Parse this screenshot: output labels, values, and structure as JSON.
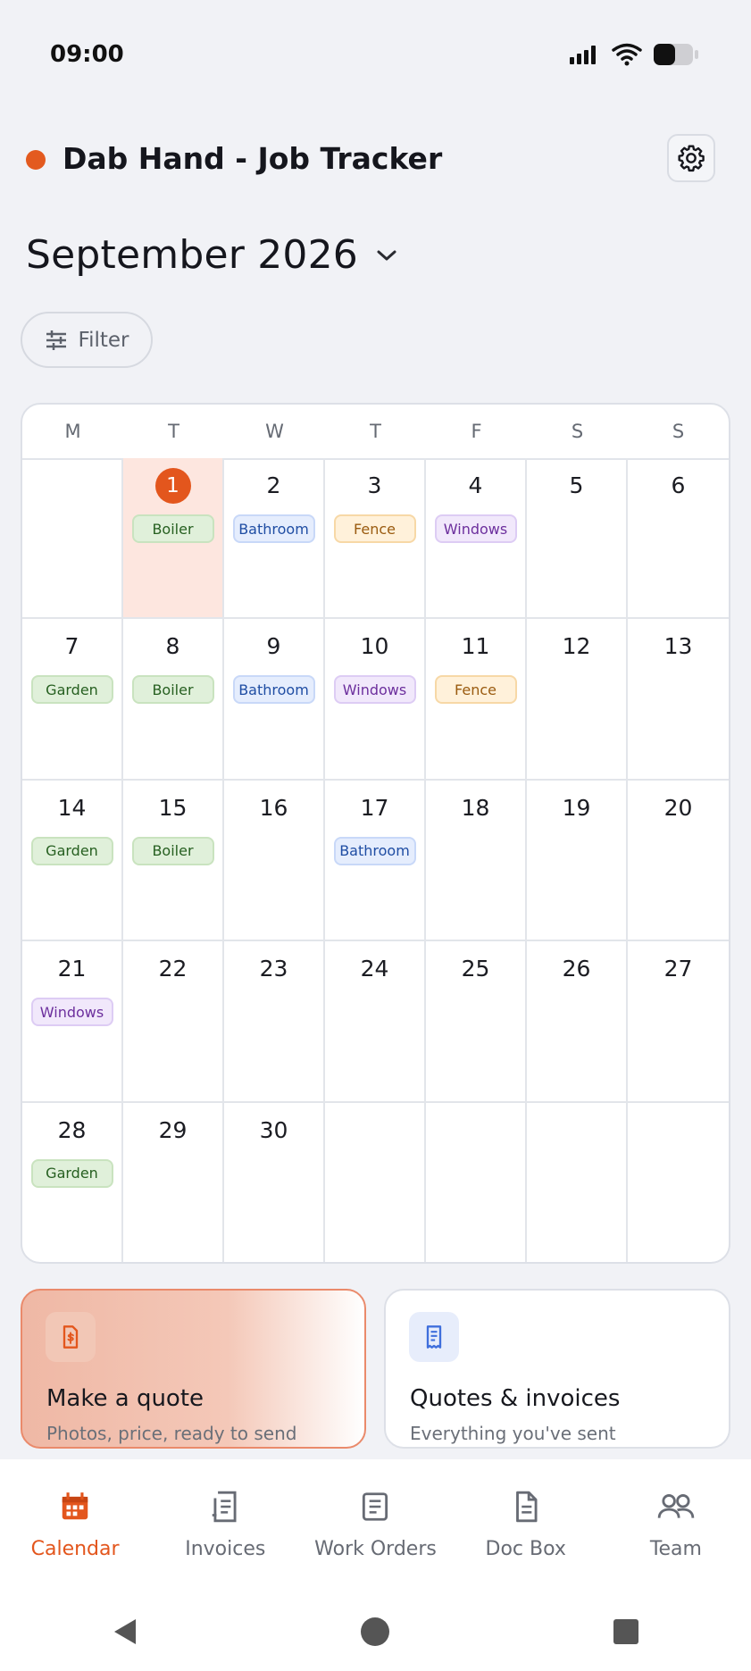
{
  "status_bar": {
    "time": "09:00",
    "icons": [
      "signal-icon",
      "wifi-icon",
      "battery-icon"
    ]
  },
  "header": {
    "title": "Dab Hand - Job Tracker",
    "icons": [
      "brand-dot-icon",
      "gear-icon"
    ],
    "accent_color": "#e35a1f"
  },
  "calendar": {
    "month_label": "September 2026",
    "filter_label": "Filter",
    "weekdays": [
      "M",
      "T",
      "W",
      "T",
      "F",
      "S",
      "S"
    ],
    "today": "1",
    "cells": [
      {
        "day": "",
        "tag": ""
      },
      {
        "day": "1",
        "tag": "Boiler"
      },
      {
        "day": "2",
        "tag": "Bathroom"
      },
      {
        "day": "3",
        "tag": "Fence"
      },
      {
        "day": "4",
        "tag": "Windows"
      },
      {
        "day": "5",
        "tag": ""
      },
      {
        "day": "6",
        "tag": ""
      },
      {
        "day": "7",
        "tag": "Garden"
      },
      {
        "day": "8",
        "tag": "Boiler"
      },
      {
        "day": "9",
        "tag": "Bathroom"
      },
      {
        "day": "10",
        "tag": "Windows"
      },
      {
        "day": "11",
        "tag": "Fence"
      },
      {
        "day": "12",
        "tag": ""
      },
      {
        "day": "13",
        "tag": ""
      },
      {
        "day": "14",
        "tag": "Garden"
      },
      {
        "day": "15",
        "tag": "Boiler"
      },
      {
        "day": "16",
        "tag": ""
      },
      {
        "day": "17",
        "tag": "Bathroom"
      },
      {
        "day": "18",
        "tag": ""
      },
      {
        "day": "19",
        "tag": ""
      },
      {
        "day": "20",
        "tag": ""
      },
      {
        "day": "21",
        "tag": "Windows"
      },
      {
        "day": "22",
        "tag": ""
      },
      {
        "day": "23",
        "tag": ""
      },
      {
        "day": "24",
        "tag": ""
      },
      {
        "day": "25",
        "tag": ""
      },
      {
        "day": "26",
        "tag": ""
      },
      {
        "day": "27",
        "tag": ""
      },
      {
        "day": "28",
        "tag": "Garden"
      },
      {
        "day": "29",
        "tag": ""
      },
      {
        "day": "30",
        "tag": ""
      },
      {
        "day": "",
        "tag": ""
      },
      {
        "day": "",
        "tag": ""
      },
      {
        "day": "",
        "tag": ""
      },
      {
        "day": "",
        "tag": ""
      }
    ]
  },
  "actions": {
    "quote": {
      "title": "Make a quote",
      "subtitle": "Photos, price, ready to send",
      "icon": "quote-document-icon"
    },
    "invoices": {
      "title": "Quotes & invoices",
      "subtitle": "Everything you've sent",
      "icon": "receipt-icon"
    }
  },
  "bottom_nav": {
    "items": [
      {
        "label": "Calendar",
        "icon": "calendar-icon"
      },
      {
        "label": "Invoices",
        "icon": "invoice-icon"
      },
      {
        "label": "Work Orders",
        "icon": "work-orders-icon"
      },
      {
        "label": "Doc Box",
        "icon": "document-icon"
      },
      {
        "label": "Team",
        "icon": "team-icon"
      }
    ],
    "active": "Calendar"
  },
  "system_nav": {
    "icons": [
      "back-icon",
      "home-icon",
      "recents-icon"
    ]
  }
}
